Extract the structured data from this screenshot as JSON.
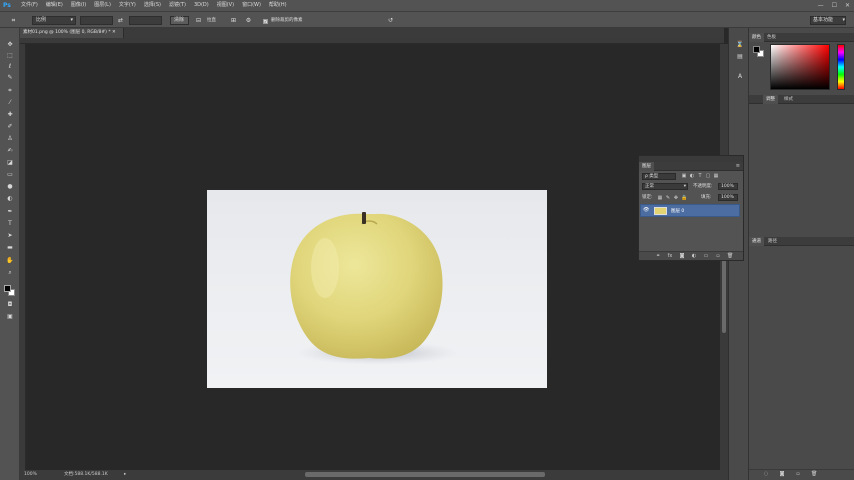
{
  "app": {
    "logo": "Ps",
    "menu": [
      "文件(F)",
      "编辑(E)",
      "图像(I)",
      "图层(L)",
      "文字(Y)",
      "选择(S)",
      "滤镜(T)",
      "3D(D)",
      "视图(V)",
      "窗口(W)",
      "帮助(H)"
    ],
    "window_controls": [
      "—",
      "☐",
      "✕"
    ]
  },
  "options_bar": {
    "ratio_label": "比例",
    "clear_button": "清除",
    "straighten_label": "拉直",
    "delete_cropped_label": "删除裁剪的像素",
    "delete_cropped_checked": true,
    "workspace": "基本功能"
  },
  "document": {
    "tab_title": "素材01.png @ 100% (图层 0, RGB/8#) *"
  },
  "status": {
    "zoom": "100%",
    "doc_info": "文档:588.1K/588.1K"
  },
  "right_panel": {
    "color_tabs": [
      "颜色",
      "色板"
    ],
    "adjust_tabs": [
      "调整",
      "样式"
    ],
    "bottom_tabs": [
      "通道",
      "路径"
    ]
  },
  "layers_panel": {
    "tab_label": "图层",
    "filter_kind": "ρ 类型",
    "blend_mode": "正常",
    "opacity_label": "不透明度:",
    "opacity_value": "100%",
    "lock_label": "锁定:",
    "fill_label": "填充:",
    "fill_value": "100%",
    "layers": [
      {
        "name": "图层 0",
        "visible": true,
        "selected": true
      }
    ]
  },
  "colors": {
    "accent": "#4c6da2",
    "fg_swatch": "#000000",
    "bg_swatch": "#ffffff"
  }
}
